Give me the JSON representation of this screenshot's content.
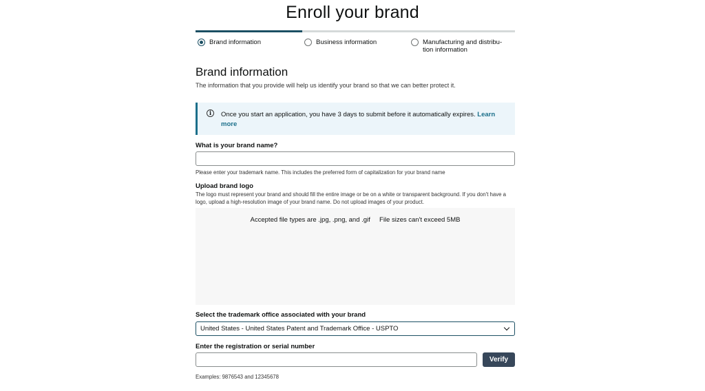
{
  "page": {
    "title": "Enroll your brand"
  },
  "progress": {
    "fraction": 0.333
  },
  "steps": [
    {
      "label": "Brand information",
      "active": true
    },
    {
      "label": "Business information",
      "active": false
    },
    {
      "label": "Manufacturing and distribu-tion information",
      "active": false
    }
  ],
  "section": {
    "title": "Brand information",
    "description": "The information that you provide will help us identify your brand so that we can better protect it."
  },
  "alert": {
    "icon": "info-icon",
    "text": "Once you start an application, you have 3 days to submit before it automatically expires.",
    "link": "Learn more"
  },
  "brand_name": {
    "label": "What is your brand name?",
    "value": "",
    "placeholder": "",
    "hint": "Please enter your trademark name. This includes the preferred form of capitalization for your brand name"
  },
  "logo": {
    "label": "Upload brand logo",
    "hint": "The logo must represent your brand and should fill the entire image or be on a white or transparent background. If you don't have a logo, upload a high-resolution image of your brand name. Do not upload images of your product.",
    "accepted": "Accepted file types are .jpg, .png, and .gif",
    "size_limit": "File sizes can't exceed 5MB"
  },
  "trademark_office": {
    "label": "Select the trademark office associated with your brand",
    "selected": "United States - United States Patent and Trademark Office - USPTO"
  },
  "registration": {
    "label": "Enter the registration or serial number",
    "value": "",
    "verify_label": "Verify",
    "examples": "Examples: 9876543 and 12345678"
  },
  "colors": {
    "accent": "#1b4f63",
    "button": "#37475a",
    "alert_bg": "#ecf5fa"
  }
}
